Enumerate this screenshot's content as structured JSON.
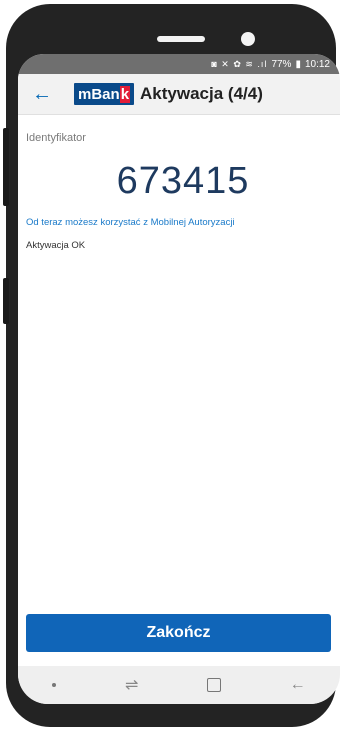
{
  "status_bar": {
    "icons": "◙ ✕ ✿ ≋ .ıl",
    "battery": "77%",
    "time": "10:12"
  },
  "app_bar": {
    "back_icon": "←",
    "logo_text_main": "mBan",
    "logo_text_k": "k",
    "title": "Aktywacja (4/4)"
  },
  "content": {
    "identifier_label": "Identyfikator",
    "identifier_value": "673415",
    "info_text": "Od teraz możesz korzystać z Mobilnej Autoryzacji",
    "status_text": "Aktywacja OK"
  },
  "actions": {
    "finish_label": "Zakończ"
  },
  "nav_bar": {
    "back_glyph": "←",
    "recents_glyph": "⇌"
  },
  "colors": {
    "accent": "#1065b8",
    "info_link": "#1a7ac9",
    "logo_blue": "#0a4a8a",
    "logo_red": "#e21d38"
  }
}
